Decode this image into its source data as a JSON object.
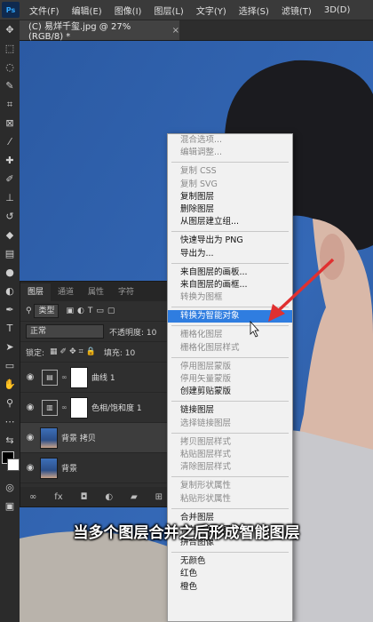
{
  "app": {
    "logo": "Ps"
  },
  "menubar": {
    "items": [
      "文件(F)",
      "编辑(E)",
      "图像(I)",
      "图层(L)",
      "文字(Y)",
      "选择(S)",
      "滤镜(T)",
      "3D(D)"
    ]
  },
  "document_tab": {
    "title": "(C) 易烊千玺.jpg @ 27%(RGB/8) *",
    "close": "×"
  },
  "toolbar_icons": [
    "move-icon",
    "marquee-icon",
    "lasso-icon",
    "quick-select-icon",
    "crop-icon",
    "frame-icon",
    "eyedropper-icon",
    "heal-icon",
    "brush-icon",
    "stamp-icon",
    "history-brush-icon",
    "eraser-icon",
    "gradient-icon",
    "blur-icon",
    "dodge-icon",
    "pen-icon",
    "type-icon",
    "path-select-icon",
    "shape-icon",
    "hand-icon",
    "zoom-icon"
  ],
  "layers_panel": {
    "tabs": [
      "图层",
      "通道",
      "属性",
      "字符"
    ],
    "filter_label": "类型",
    "blend_mode": "正常",
    "opacity_label": "不透明度: 10",
    "lock_label": "锁定:",
    "fill_label": "填充: 10",
    "layers": [
      {
        "name": "曲线 1",
        "kind": "adjustment"
      },
      {
        "name": "色相/饱和度 1",
        "kind": "adjustment"
      },
      {
        "name": "背景 拷贝",
        "kind": "photo"
      },
      {
        "name": "背景",
        "kind": "photo"
      }
    ]
  },
  "context_menu": {
    "groups": [
      [
        {
          "label": "混合选项...",
          "disabled": true
        },
        {
          "label": "编辑调整...",
          "disabled": true
        }
      ],
      [
        {
          "label": "复制 CSS",
          "disabled": true
        },
        {
          "label": "复制 SVG",
          "disabled": true
        },
        {
          "label": "复制图层"
        },
        {
          "label": "删除图层"
        },
        {
          "label": "从图层建立组..."
        }
      ],
      [
        {
          "label": "快速导出为 PNG"
        },
        {
          "label": "导出为..."
        }
      ],
      [
        {
          "label": "来自图层的画板..."
        },
        {
          "label": "来自图层的画框..."
        },
        {
          "label": "转换为图框",
          "disabled": true
        }
      ],
      [
        {
          "label": "转换为智能对象",
          "highlighted": true
        }
      ],
      [
        {
          "label": "栅格化图层",
          "disabled": true
        },
        {
          "label": "栅格化图层样式",
          "disabled": true
        }
      ],
      [
        {
          "label": "停用图层蒙版",
          "disabled": true
        },
        {
          "label": "停用矢量蒙版",
          "disabled": true
        },
        {
          "label": "创建剪贴蒙版"
        }
      ],
      [
        {
          "label": "链接图层"
        },
        {
          "label": "选择链接图层",
          "disabled": true
        }
      ],
      [
        {
          "label": "拷贝图层样式",
          "disabled": true
        },
        {
          "label": "粘贴图层样式",
          "disabled": true
        },
        {
          "label": "清除图层样式",
          "disabled": true
        }
      ],
      [
        {
          "label": "复制形状属性",
          "disabled": true
        },
        {
          "label": "粘贴形状属性",
          "disabled": true
        }
      ],
      [
        {
          "label": "合并图层"
        },
        {
          "label": "合并可见图层"
        },
        {
          "label": "拼合图像"
        }
      ],
      [
        {
          "label": "无颜色"
        },
        {
          "label": "红色"
        },
        {
          "label": "橙色"
        }
      ]
    ]
  },
  "subtitle": "当多个图层合并之后形成智能图层",
  "colors": {
    "accent": "#2f7de0",
    "arrow": "#e03030",
    "canvas_bg": "#2f63ad"
  }
}
